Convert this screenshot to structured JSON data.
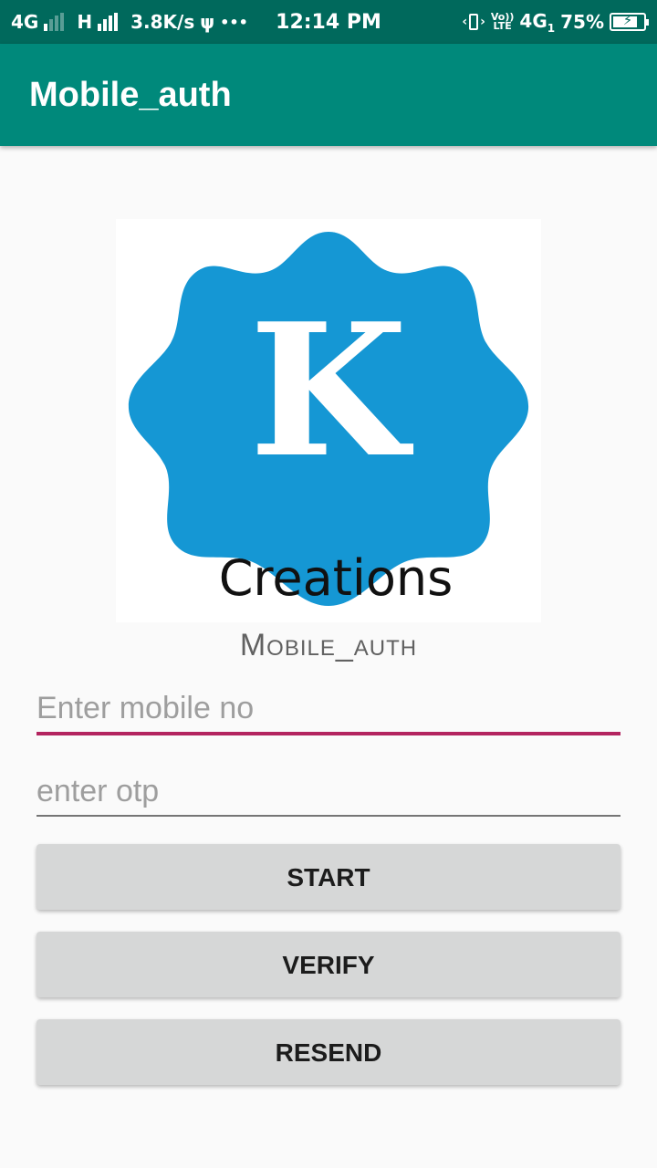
{
  "status_bar": {
    "network1": "4G",
    "network2": "H",
    "speed": "3.8K/s",
    "usb_icon": "usb-icon",
    "more": "•••",
    "time": "12:14 PM",
    "vibrate_icon": "vibrate-icon",
    "volte_top": "Vo))",
    "volte_bottom": "LTE",
    "network3": "4G",
    "sim_index": "1",
    "battery": "75%"
  },
  "app_bar": {
    "title": "Mobile_auth"
  },
  "logo": {
    "letter": "K",
    "text": "Creations",
    "color": "#1597d4"
  },
  "subtitle": "Mobile_auth",
  "form": {
    "mobile": {
      "placeholder": "Enter mobile no",
      "value": ""
    },
    "otp": {
      "placeholder": "enter otp",
      "value": ""
    }
  },
  "buttons": {
    "start": "START",
    "verify": "VERIFY",
    "resend": "RESEND"
  },
  "colors": {
    "status_bar": "#00695c",
    "app_bar": "#00897b",
    "accent_underline": "#b3245f",
    "button_bg": "#d6d7d7"
  }
}
